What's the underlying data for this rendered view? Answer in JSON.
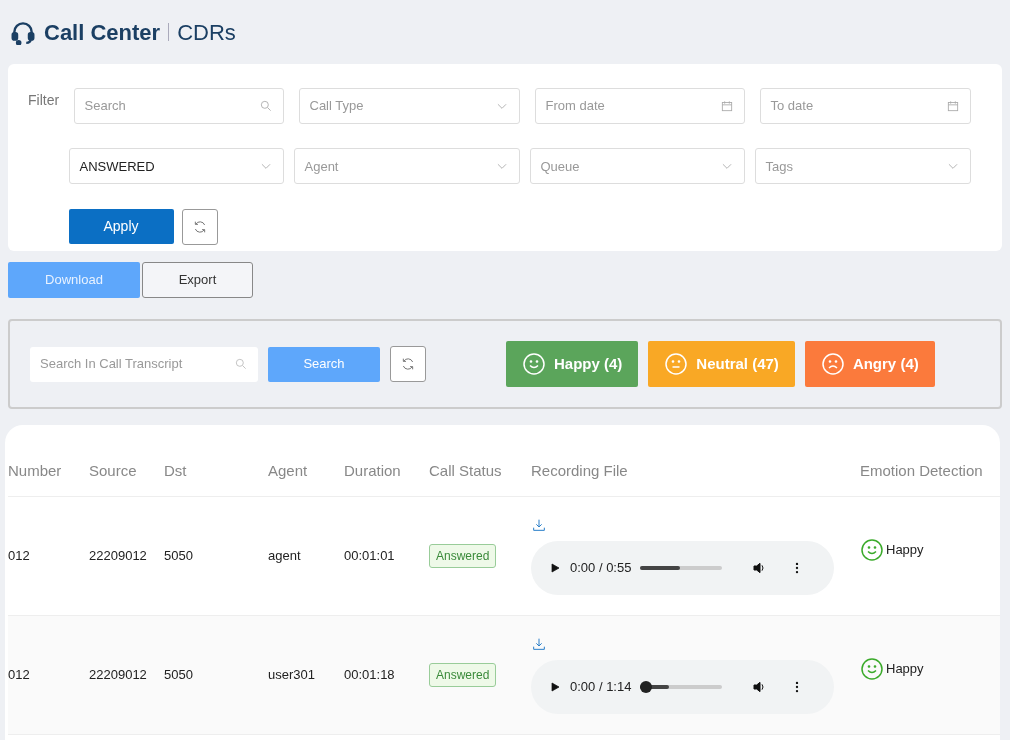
{
  "header": {
    "title": "Call Center",
    "subtitle": "CDRs"
  },
  "filter": {
    "label": "Filter",
    "fields": [
      {
        "kind": "search",
        "placeholder": "Search"
      },
      {
        "kind": "select",
        "placeholder": "Call Type"
      },
      {
        "kind": "date",
        "placeholder": "From date"
      },
      {
        "kind": "date",
        "placeholder": "To date"
      },
      {
        "kind": "select",
        "value": "ANSWERED"
      },
      {
        "kind": "select",
        "placeholder": "Agent"
      },
      {
        "kind": "select",
        "placeholder": "Queue"
      },
      {
        "kind": "select",
        "placeholder": "Tags"
      }
    ],
    "apply_button": "Apply"
  },
  "actions": [
    "Download",
    "Export"
  ],
  "transcript_search": {
    "placeholder": "Search In Call Transcript",
    "button": "Search"
  },
  "emotions": [
    {
      "kind": "happy",
      "label": "Happy (4)",
      "color": "#5ba55b"
    },
    {
      "kind": "neutral",
      "label": "Neutral (47)",
      "color": "#f9a825"
    },
    {
      "kind": "angry",
      "label": "Angry (4)",
      "color": "#fb7a3c"
    }
  ],
  "table": {
    "columns": [
      "Number",
      "Source",
      "Dst",
      "Agent",
      "Duration",
      "Call Status",
      "Recording File",
      "Emotion Detection"
    ],
    "rows": [
      {
        "number": "012",
        "source": "22209012",
        "dst": "5050",
        "agent": "agent",
        "duration": "00:01:01",
        "status": "Answered",
        "player": {
          "time": "0:00 / 0:55",
          "level": 0.48,
          "thumb": false
        },
        "emotion": {
          "kind": "happy",
          "label": "Happy"
        }
      },
      {
        "number": "012",
        "source": "22209012",
        "dst": "5050",
        "agent": "user301",
        "duration": "00:01:18",
        "status": "Answered",
        "player": {
          "time": "0:00 / 1:14",
          "level": 0.35,
          "thumb": true
        },
        "emotion": {
          "kind": "happy",
          "label": "Happy"
        }
      }
    ]
  }
}
